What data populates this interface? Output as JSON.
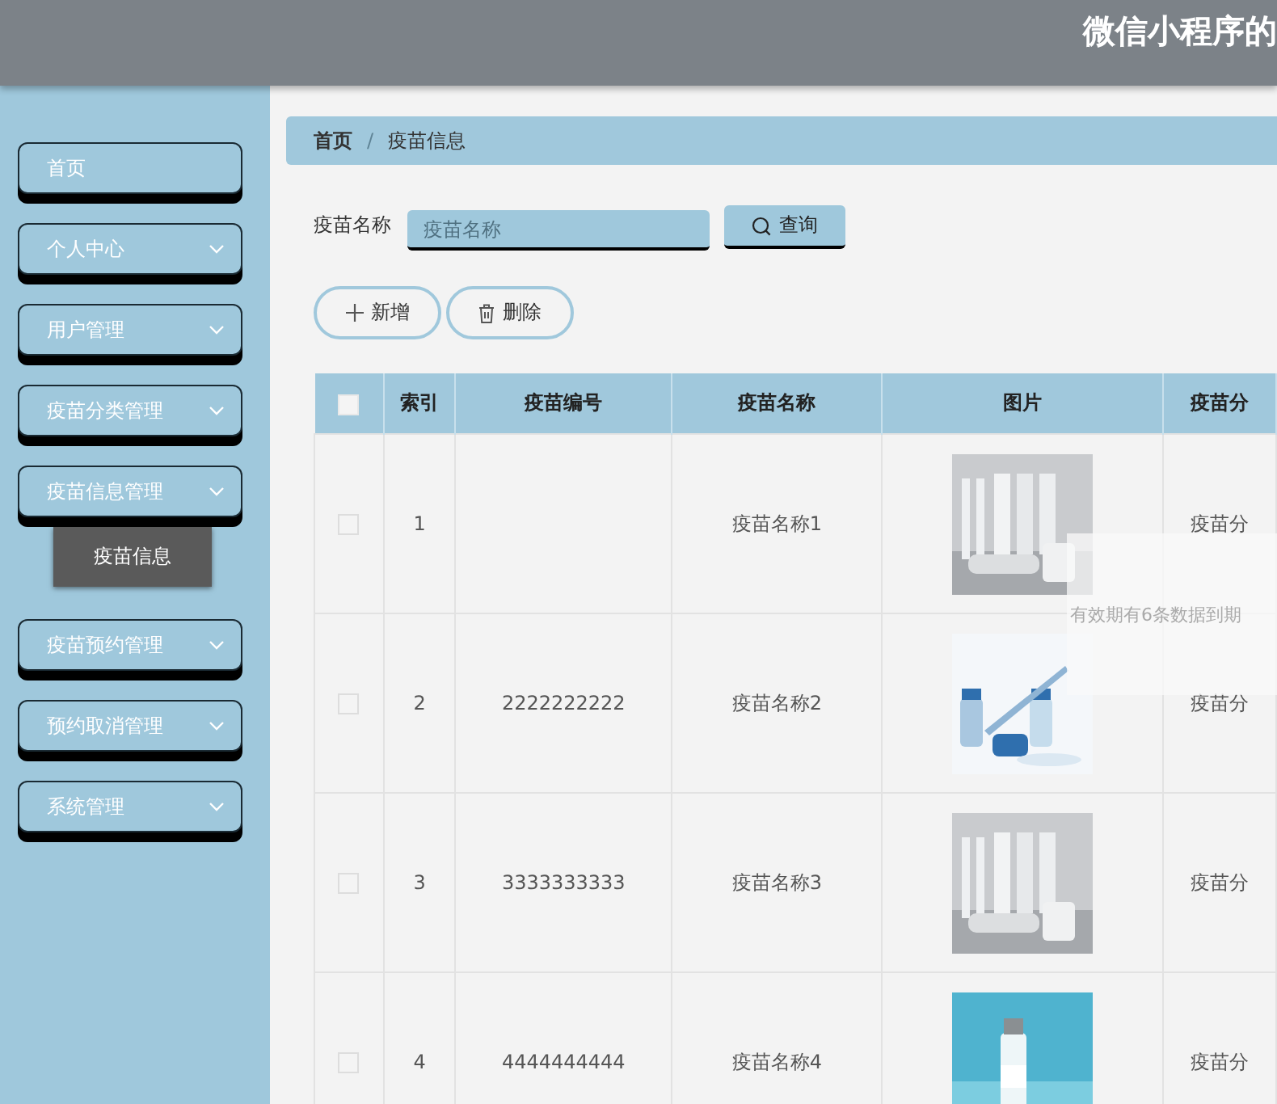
{
  "header": {
    "title": "微信小程序的"
  },
  "sidebar": {
    "items": [
      {
        "label": "首页",
        "expandable": false
      },
      {
        "label": "个人中心",
        "expandable": true
      },
      {
        "label": "用户管理",
        "expandable": true
      },
      {
        "label": "疫苗分类管理",
        "expandable": true
      },
      {
        "label": "疫苗信息管理",
        "expandable": true,
        "children": [
          {
            "label": "疫苗信息",
            "selected": true
          }
        ]
      },
      {
        "label": "疫苗预约管理",
        "expandable": true
      },
      {
        "label": "预约取消管理",
        "expandable": true
      },
      {
        "label": "系统管理",
        "expandable": true
      }
    ]
  },
  "breadcrumb": {
    "separator": "/",
    "items": [
      {
        "label": "首页"
      },
      {
        "label": "疫苗信息"
      }
    ]
  },
  "search": {
    "label": "疫苗名称",
    "placeholder": "疫苗名称",
    "button": "查询"
  },
  "actions": [
    {
      "kind": "add",
      "label": "新增"
    },
    {
      "kind": "delete",
      "label": "删除"
    }
  ],
  "table": {
    "columns": [
      {
        "kind": "checkbox",
        "checked": false
      },
      {
        "kind": "text",
        "label": "索引"
      },
      {
        "kind": "text",
        "label": "疫苗编号"
      },
      {
        "kind": "text",
        "label": "疫苗名称"
      },
      {
        "kind": "text",
        "label": "图片"
      },
      {
        "kind": "text",
        "label": "疫苗分"
      }
    ],
    "rows": [
      {
        "checked": false,
        "index": "1",
        "name": "疫苗名称1",
        "column_6": "疫苗分"
      },
      {
        "checked": false,
        "index": "2",
        "code": "2222222222",
        "name": "疫苗名称2",
        "column_6": "疫苗分"
      },
      {
        "checked": false,
        "index": "3",
        "code": "3333333333",
        "name": "疫苗名称3",
        "column_6": "疫苗分"
      },
      {
        "checked": false,
        "index": "4",
        "code": "4444444444",
        "name": "疫苗名称4",
        "column_6": "疫苗分"
      }
    ]
  },
  "toast": {
    "message": "有效期有6条数据到期"
  }
}
